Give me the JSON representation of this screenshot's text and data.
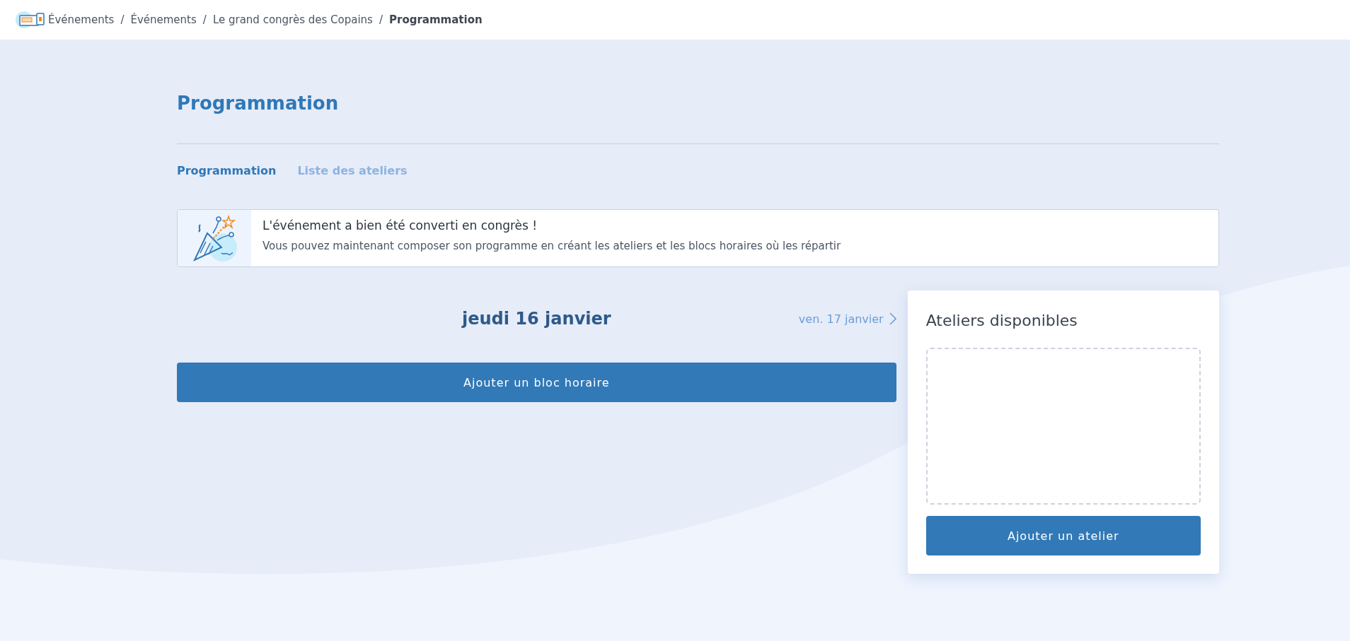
{
  "breadcrumb": [
    {
      "label": "Événements",
      "current": false
    },
    {
      "label": "Événements",
      "current": false
    },
    {
      "label": "Le grand congrès des Copains",
      "current": false
    },
    {
      "label": "Programmation",
      "current": true
    }
  ],
  "breadcrumb_separator": "/",
  "page_title": "Programmation",
  "tabs": [
    {
      "label": "Programmation",
      "selected": true
    },
    {
      "label": "Liste des ateliers",
      "selected": false
    }
  ],
  "alert": {
    "title": "L'événement a bien été converti en congrès !",
    "message": "Vous pouvez maintenant composer son programme en créant les ateliers et les blocs horaires où les répartir"
  },
  "day": {
    "current": "jeudi 16 janvier",
    "next": "ven. 17 janvier"
  },
  "add_block_button": "Ajouter un bloc horaire",
  "workshops_panel": {
    "title": "Ateliers disponibles",
    "add_button": "Ajouter un atelier"
  }
}
